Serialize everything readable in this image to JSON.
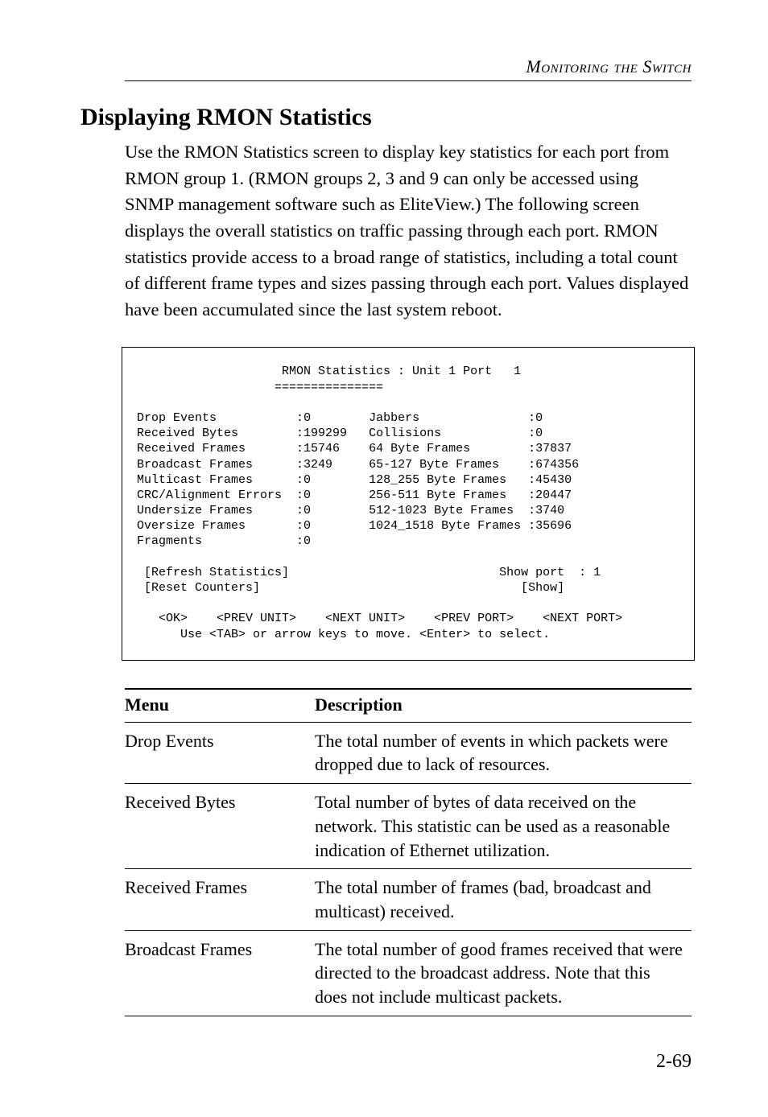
{
  "header": {
    "running_title": "Monitoring the Switch"
  },
  "section": {
    "title": "Displaying RMON Statistics",
    "paragraph": "Use the RMON Statistics screen to display key statistics for each port from RMON group 1. (RMON groups 2, 3 and 9 can only be accessed using SNMP management software such as EliteView.) The following screen displays the overall statistics on traffic passing through each port. RMON statistics provide access to a broad range of statistics, including a total count of different frame types and sizes passing through each port. Values displayed have been accumulated since the last system reboot."
  },
  "terminal": {
    "title": "RMON Statistics : Unit 1 Port   1",
    "rule": "===============",
    "left_stats": [
      {
        "label": "Drop Events",
        "value": "0"
      },
      {
        "label": "Received Bytes",
        "value": "199299"
      },
      {
        "label": "Received Frames",
        "value": "15746"
      },
      {
        "label": "Broadcast Frames",
        "value": "3249"
      },
      {
        "label": "Multicast Frames",
        "value": "0"
      },
      {
        "label": "CRC/Alignment Errors",
        "value": "0"
      },
      {
        "label": "Undersize Frames",
        "value": "0"
      },
      {
        "label": "Oversize Frames",
        "value": "0"
      },
      {
        "label": "Fragments",
        "value": "0"
      }
    ],
    "right_stats": [
      {
        "label": "Jabbers",
        "value": "0"
      },
      {
        "label": "Collisions",
        "value": "0"
      },
      {
        "label": "64 Byte Frames",
        "value": "37837"
      },
      {
        "label": "65-127 Byte Frames",
        "value": "674356"
      },
      {
        "label": "128_255 Byte Frames",
        "value": "45430"
      },
      {
        "label": "256-511 Byte Frames",
        "value": "20447"
      },
      {
        "label": "512-1023 Byte Frames",
        "value": "3740"
      },
      {
        "label": "1024_1518 Byte Frames",
        "value": "35696"
      }
    ],
    "buttons": {
      "refresh": "[Refresh Statistics]",
      "reset": "[Reset Counters]",
      "show_port_label": "Show port  : 1",
      "show": "[Show]"
    },
    "footer_keys": "<OK>    <PREV UNIT>    <NEXT UNIT>    <PREV PORT>    <NEXT PORT>",
    "footer_hint": "Use <TAB> or arrow keys to move. <Enter> to select."
  },
  "table": {
    "head_menu": "Menu",
    "head_desc": "Description",
    "rows": [
      {
        "menu": "Drop Events",
        "desc": "The total number of events in which packets were dropped due to lack of resources."
      },
      {
        "menu": "Received Bytes",
        "desc": "Total number of bytes of data received on the network. This statistic can be used as a reasonable indication of Ethernet utilization."
      },
      {
        "menu": "Received Frames",
        "desc": "The total number of frames (bad, broadcast and multicast) received."
      },
      {
        "menu": "Broadcast Frames",
        "desc": "The total number of good frames received that were directed to the broadcast address. Note that this does not include multicast packets."
      }
    ]
  },
  "page_number": "2-69"
}
